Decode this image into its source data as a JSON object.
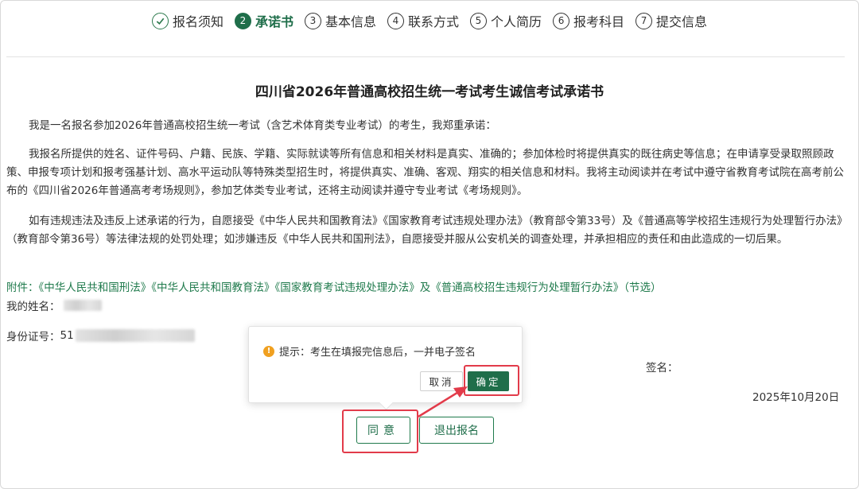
{
  "steps": [
    {
      "num": "✓",
      "label": "报名须知",
      "state": "done"
    },
    {
      "num": "2",
      "label": "承诺书",
      "state": "active"
    },
    {
      "num": "3",
      "label": "基本信息",
      "state": "todo"
    },
    {
      "num": "4",
      "label": "联系方式",
      "state": "todo"
    },
    {
      "num": "5",
      "label": "个人简历",
      "state": "todo"
    },
    {
      "num": "6",
      "label": "报考科目",
      "state": "todo"
    },
    {
      "num": "7",
      "label": "提交信息",
      "state": "todo"
    }
  ],
  "document": {
    "title": "四川省2026年普通高校招生统一考试考生诚信考试承诺书",
    "paragraphs": [
      "我是一名报名参加2026年普通高校招生统一考试（含艺术体育类专业考试）的考生，我郑重承诺：",
      "我报名所提供的姓名、证件号码、户籍、民族、学籍、实际就读等所有信息和相关材料是真实、准确的；参加体检时将提供真实的既往病史等信息；在申请享受录取照顾政策、申报专项计划和报考强基计划、高水平运动队等特殊类型招生时，将提供真实、准确、客观、翔实的相关信息和材料。我将主动阅读并在考试中遵守省教育考试院在高考前公布的《四川省2026年普通高考考场规则》，参加艺体类专业考试，还将主动阅读并遵守专业考试《考场规则》。",
      "如有违规违法及违反上述承诺的行为，自愿接受《中华人民共和国教育法》《国家教育考试违规处理办法》（教育部令第33号）及《普通高等学校招生违规行为处理暂行办法》（教育部令第36号）等法律法规的处罚处理；如涉嫌违反《中华人民共和国刑法》，自愿接受并服从公安机关的调查处理，并承担相应的责任和由此造成的一切后果。"
    ],
    "attachment": "附件：《中华人民共和国刑法》《中华人民共和国教育法》《国家教育考试违规处理办法》及《普通高校招生违规行为处理暂行办法》（节选）",
    "name_label": "我的姓名：",
    "id_label": "身份证号：",
    "id_prefix": "51",
    "sign_label": "签名：",
    "date": "2025年10月20日"
  },
  "popup": {
    "message": "提示：考生在填报完信息后，一并电子签名",
    "cancel": "取消",
    "confirm": "确定"
  },
  "buttons": {
    "agree": "同意",
    "exit": "退出报名"
  },
  "colors": {
    "primary_green": "#1f6e4a",
    "highlight_red": "#e23b4a",
    "warning": "#f0a020"
  }
}
